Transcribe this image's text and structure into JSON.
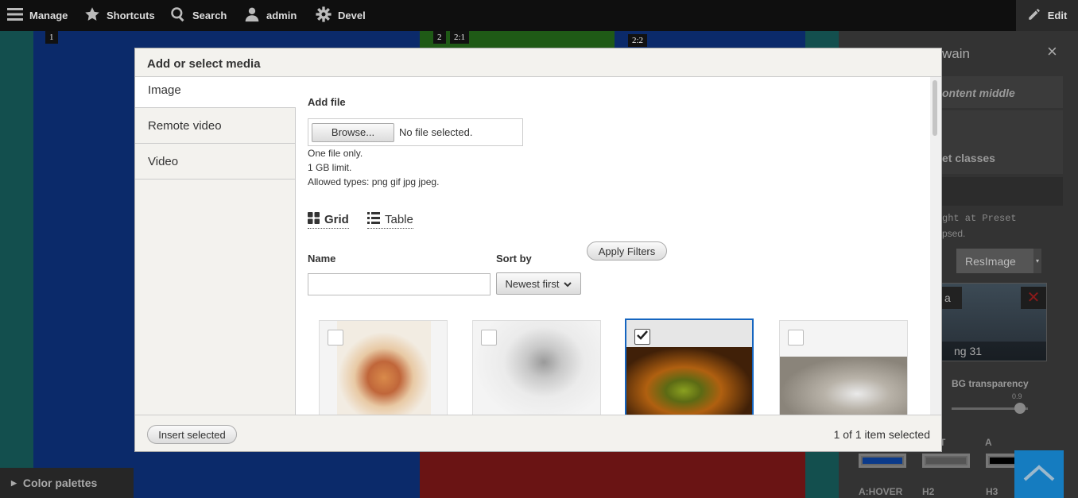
{
  "toolbar": {
    "manage": "Manage",
    "shortcuts": "Shortcuts",
    "search": "Search",
    "user": "admin",
    "devel": "Devel",
    "edit": "Edit"
  },
  "background": {
    "region_1": "1",
    "region_2": "2",
    "region_21": "2:1",
    "region_22": "2:2"
  },
  "right_panel": {
    "title_fragment": "wain",
    "close": "×",
    "section_fragment": "ontent middle",
    "classes_fragment": "et classes",
    "preset_fragment_1": "ght at ",
    "preset_word": "Preset",
    "preset_fragment_2": "psed.",
    "select_value": "ResImage",
    "thumb_caption_a": "a",
    "thumb_caption_b": "ng 31",
    "bg_transparency_label": "BG transparency",
    "bg_transparency_value": "0.9",
    "bg_transparency": 0.9,
    "col_t": "T",
    "col_a": "A",
    "row_ahover": "A:HOVER",
    "row_h2": "H2",
    "row_h3": "H3"
  },
  "color_palettes": "Color palettes",
  "modal": {
    "title": "Add or select media",
    "tabs": [
      "Image",
      "Remote video",
      "Video"
    ],
    "active_tab": "Image",
    "add_file_label": "Add file",
    "browse_button": "Browse...",
    "no_file_text": "No file selected.",
    "help_one_file": "One file only.",
    "help_limit": "1 GB limit.",
    "help_types": "Allowed types: png gif jpg jpeg.",
    "view_grid": "Grid",
    "view_table": "Table",
    "name_label": "Name",
    "name_value": "",
    "sort_label": "Sort by",
    "sort_value": "Newest first",
    "apply_filters": "Apply Filters",
    "media_items": [
      {
        "checked": false
      },
      {
        "checked": false
      },
      {
        "checked": true
      },
      {
        "checked": false
      }
    ],
    "insert_selected": "Insert selected",
    "selection_status": "1 of 1 item selected"
  },
  "colors": {
    "accent": "#1565c0",
    "toolbar_bg": "#0f0f0f",
    "modal_header_bg": "#f3f2ee"
  }
}
